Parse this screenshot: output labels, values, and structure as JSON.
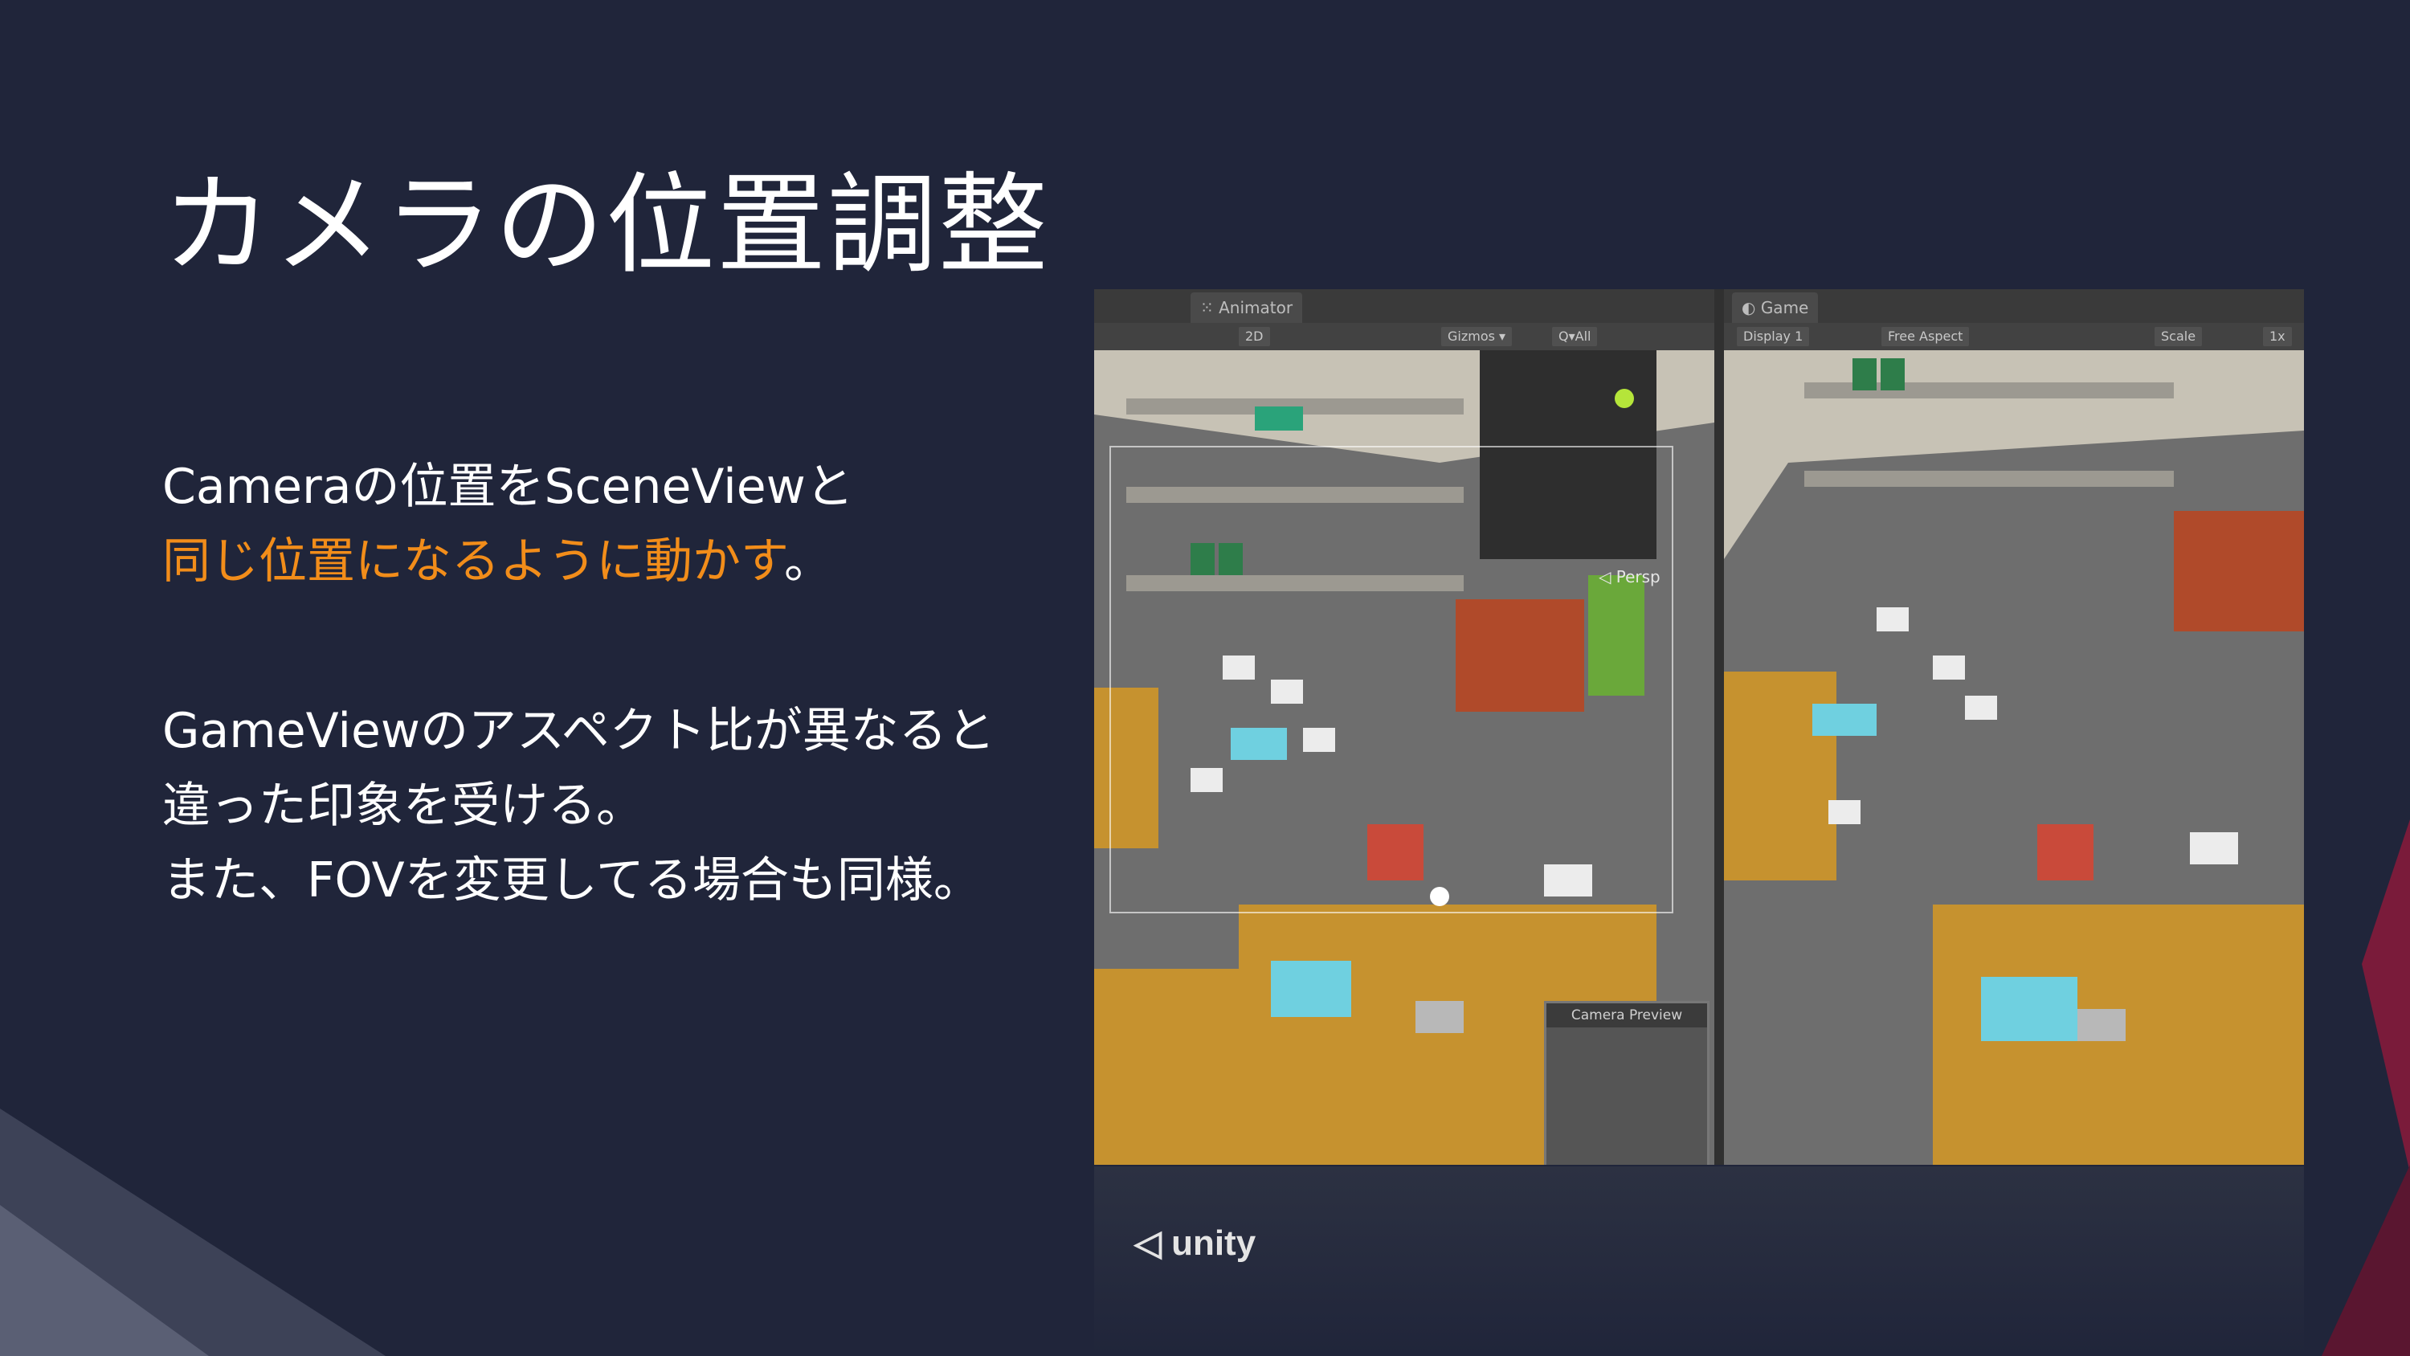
{
  "slide": {
    "title": "カメラの位置調整",
    "para1_line1": "Cameraの位置をSceneViewと",
    "para1_line2": "同じ位置になるように動かす",
    "para1_line2_end": "。",
    "para2_line1": "GameViewのアスペクト比が異なると",
    "para2_line2": "違った印象を受ける。",
    "para2_line3": "また、FOVを変更してる場合も同様。"
  },
  "screenshot": {
    "scene_tab": "Animator",
    "game_tab": "Game",
    "scene_toolbar": [
      "2D",
      "Gizmos ▾",
      "Q▾All"
    ],
    "game_toolbar": [
      "Display 1",
      "Free Aspect",
      "Scale",
      "1x"
    ],
    "persp_label": "◁ Persp",
    "camera_preview_label": "Camera Preview",
    "logo_text": "unity"
  },
  "colors": {
    "background": "#20253a",
    "title": "#ffffff",
    "highlight": "#f28d1a",
    "floor": "#6e6e6e",
    "desk": "#c6922f",
    "wall": "#c7c2b5"
  }
}
